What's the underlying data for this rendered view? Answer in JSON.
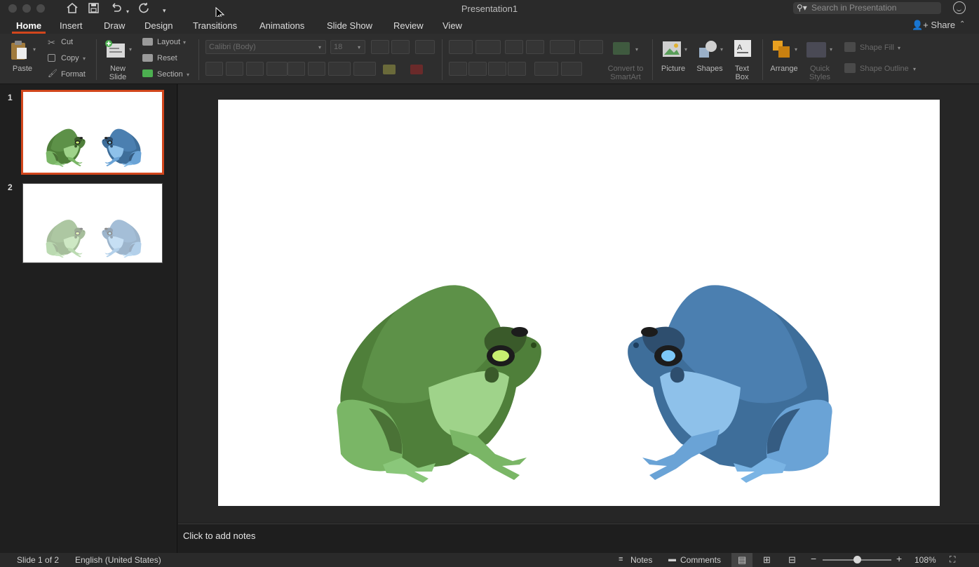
{
  "window": {
    "title": "Presentation1"
  },
  "search": {
    "placeholder": "Search in Presentation"
  },
  "tabs": [
    "Home",
    "Insert",
    "Draw",
    "Design",
    "Transitions",
    "Animations",
    "Slide Show",
    "Review",
    "View"
  ],
  "active_tab": "Home",
  "share_label": "Share",
  "ribbon": {
    "paste": "Paste",
    "cut": "Cut",
    "copy": "Copy",
    "format": "Format",
    "new_slide_1": "New",
    "new_slide_2": "Slide",
    "layout": "Layout",
    "reset": "Reset",
    "section": "Section",
    "font_name": "Calibri (Body)",
    "font_size": "18",
    "convert_1": "Convert to",
    "convert_2": "SmartArt",
    "picture": "Picture",
    "shapes": "Shapes",
    "textbox_1": "Text",
    "textbox_2": "Box",
    "arrange": "Arrange",
    "quick_styles_1": "Quick",
    "quick_styles_2": "Styles",
    "shape_fill": "Shape Fill",
    "shape_outline": "Shape Outline"
  },
  "slides": [
    {
      "number": "1",
      "selected": true
    },
    {
      "number": "2",
      "selected": false
    }
  ],
  "notes": {
    "placeholder": "Click to add notes"
  },
  "status": {
    "slide_position": "Slide 1 of 2",
    "language": "English (United States)",
    "notes": "Notes",
    "comments": "Comments",
    "zoom": "108%"
  },
  "colors": {
    "accent": "#d2461c",
    "frog_green": "#6aa84f",
    "frog_blue": "#4f86b8"
  }
}
